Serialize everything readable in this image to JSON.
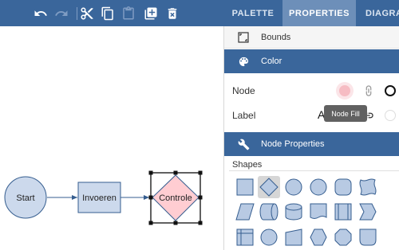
{
  "toolbar": {
    "buttons": [
      {
        "name": "undo",
        "enabled": true
      },
      {
        "name": "redo",
        "enabled": false
      },
      {
        "name": "cut",
        "enabled": true
      },
      {
        "name": "copy",
        "enabled": true
      },
      {
        "name": "paste",
        "enabled": false
      },
      {
        "name": "add-node",
        "enabled": true
      },
      {
        "name": "delete",
        "enabled": true
      }
    ],
    "tabs": [
      {
        "label": "PALETTE",
        "active": false
      },
      {
        "label": "PROPERTIES",
        "active": true
      },
      {
        "label": "DIAGRAM",
        "active": false
      }
    ]
  },
  "colors": {
    "topbar": "#3a669b",
    "active_tab": "#6d8fb9",
    "node_fill": "#ccd9ec",
    "node_stroke": "#355d8f",
    "decision_fill": "#ffcdd2",
    "node_fill_swatch": "#f6bcc3",
    "selection": "#616161"
  },
  "diagram": {
    "nodes": [
      {
        "id": "start",
        "shape": "circle",
        "label": "Start"
      },
      {
        "id": "invoeren",
        "shape": "rectangle",
        "label": "Invoeren"
      },
      {
        "id": "controle",
        "shape": "diamond",
        "label": "Controle",
        "selected": true
      }
    ],
    "edges": [
      {
        "from": "start",
        "to": "invoeren"
      },
      {
        "from": "invoeren",
        "to": "controle"
      }
    ]
  },
  "panel": {
    "bounds_label": "Bounds",
    "color_section": "Color",
    "node_label": "Node",
    "label_label": "Label",
    "label_value_char": "A",
    "tooltip": "Node Fill",
    "node_properties_section": "Node Properties",
    "shapes_label": "Shapes",
    "shapes": [
      "rectangle",
      "diamond",
      "circle",
      "circle",
      "rounded-rect",
      "wavy-rect",
      "parallelogram",
      "cylinder-horizontal",
      "cylinder",
      "document",
      "double-rect",
      "chevron",
      "internal-storage",
      "circle",
      "trapezoid",
      "hexagon",
      "octagon",
      "shield"
    ],
    "selected_shape_index": 1
  }
}
